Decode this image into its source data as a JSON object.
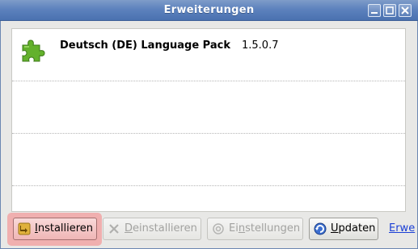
{
  "window": {
    "title": "Erweiterungen"
  },
  "extensions": [
    {
      "name": "Deutsch (DE) Language Pack",
      "version": "1.5.0.7",
      "icon": "puzzle-piece-icon"
    }
  ],
  "buttons": {
    "install": {
      "prefix": "I",
      "rest": "nstallieren",
      "enabled": true
    },
    "uninstall": {
      "prefix": "D",
      "rest": "einstallieren",
      "enabled": false
    },
    "settings": {
      "prefix": "Ei",
      "underline": "n",
      "rest": "stellungen",
      "enabled": false
    },
    "update": {
      "prefix": "U",
      "rest": "pdaten",
      "enabled": true
    }
  },
  "link": {
    "label": "Erwe"
  },
  "colors": {
    "titlebar": "#5d82bd",
    "highlight": "#f1a4a4",
    "link": "#1a3fd6",
    "puzzle": "#63b12c"
  }
}
